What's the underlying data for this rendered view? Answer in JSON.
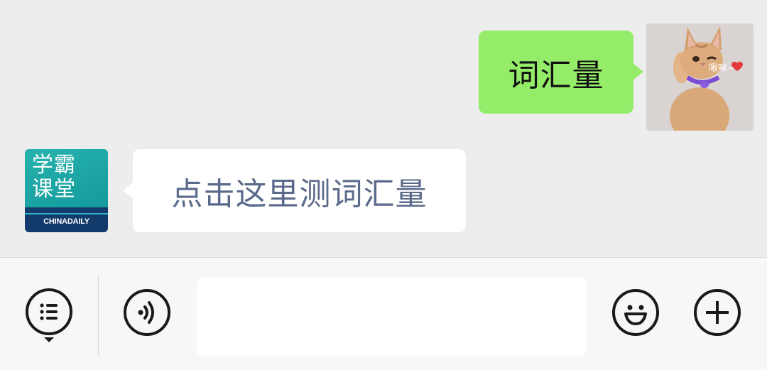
{
  "messages": {
    "outgoing": {
      "text": "词汇量",
      "sticker_caption": "啾咪~"
    },
    "incoming": {
      "text": "点击这里测词汇量",
      "avatar_line1": "学霸",
      "avatar_line2": "课堂",
      "avatar_brand": "CHINADAILY"
    }
  },
  "input_bar": {
    "text_value": "",
    "icons": [
      "menu-icon",
      "voice-icon",
      "emoji-icon",
      "plus-icon"
    ]
  },
  "colors": {
    "chat_bg": "#ededed",
    "outgoing_bubble": "#95ec69",
    "incoming_bubble": "#ffffff",
    "incoming_text": "#5a6a8a",
    "avatar_teal": "#1fa3a3",
    "avatar_navy": "#123a6b"
  }
}
